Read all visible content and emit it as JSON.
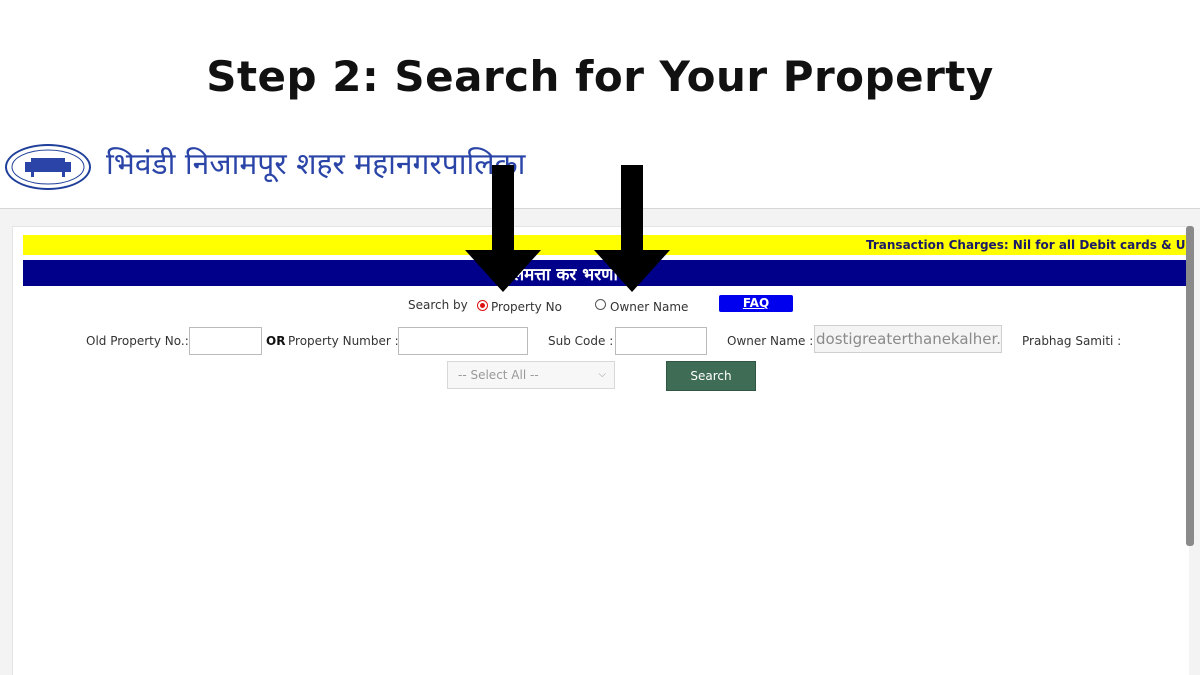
{
  "heading": "Step 2: Search for Your Property",
  "header": {
    "site_title": "भिवंडी निजामपूर शहर महानगरपालिका"
  },
  "ticker": {
    "text": "Transaction Charges: Nil for all Debit cards & UPI Pa"
  },
  "banner": {
    "title": "मालमत्ता कर भरणा"
  },
  "search_by": {
    "label": "Search by",
    "options": [
      {
        "label": "Property No",
        "selected": true
      },
      {
        "label": "Owner Name",
        "selected": false
      }
    ],
    "faq_label": "FAQ"
  },
  "form": {
    "old_property_label": "Old Property No.:",
    "old_property_value": "",
    "or_label": "OR",
    "property_number_label": "Property Number :",
    "property_number_value": "",
    "sub_code_label": "Sub Code :",
    "sub_code_value": "",
    "owner_name_label": "Owner Name :",
    "owner_name_value": "dostigreaterthanekalher.in",
    "prabhag_label": "Prabhag Samiti :",
    "prabhag_selected": "-- Select All --",
    "search_button": "Search"
  },
  "icons": {
    "arrow_1": "down-arrow-icon",
    "arrow_2": "down-arrow-icon",
    "dropdown": "chevron-down-icon"
  },
  "colors": {
    "ticker_bg": "#ffff00",
    "banner_bg": "#00008b",
    "search_button_bg": "#3f6c55",
    "faq_bg": "#0000ee",
    "title_blue": "#2a44a8"
  }
}
